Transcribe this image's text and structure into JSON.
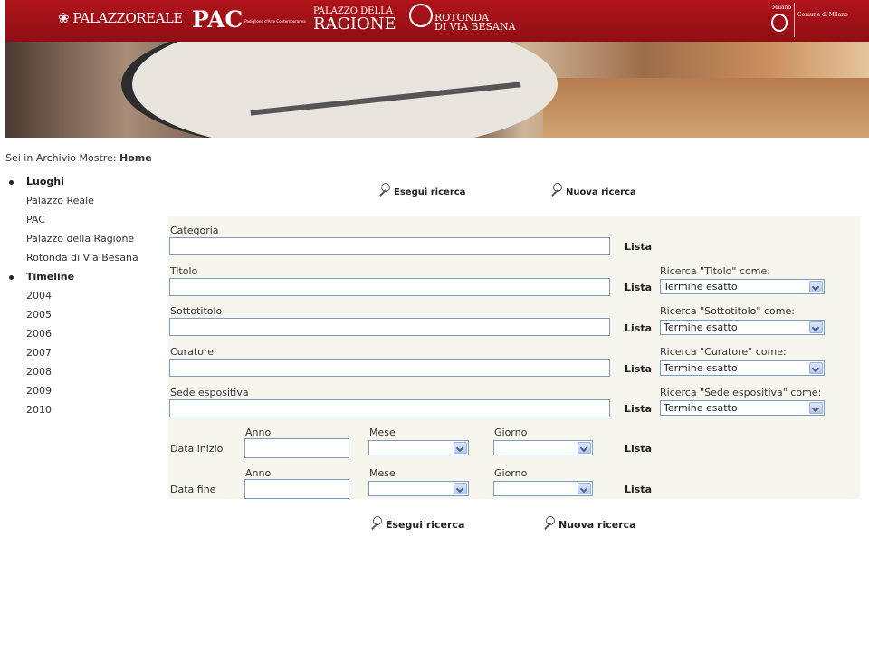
{
  "header": {
    "logos": {
      "palazzo_reale": "PALAZZOREALE",
      "pac": "PAC",
      "pac_sub": "Padiglione d'Arte Contemporanea",
      "ragione_top": "PALAZZO DELLA",
      "ragione_bottom": "RAGIONE",
      "rotonda_top": "ROTONDA",
      "rotonda_bottom": "DI VIA BESANA",
      "milano_city": "Milano",
      "milano_comune": "Comune di Milano"
    }
  },
  "breadcrumb": {
    "prefix": "Sei in Archivio Mostre: ",
    "current": "Home"
  },
  "sidebar": {
    "luoghi": {
      "title": "Luoghi",
      "items": [
        "Palazzo Reale",
        "PAC",
        "Palazzo della Ragione",
        "Rotonda di Via Besana"
      ]
    },
    "timeline": {
      "title": "Timeline",
      "items": [
        "2004",
        "2005",
        "2006",
        "2007",
        "2008",
        "2009",
        "2010"
      ]
    }
  },
  "actions": {
    "search": "Esegui ricerca",
    "new_search": "Nuova ricerca"
  },
  "form": {
    "lista": "Lista",
    "fields": {
      "categoria": {
        "label": "Categoria",
        "value": ""
      },
      "titolo": {
        "label": "Titolo",
        "value": "",
        "match_label": "Ricerca \"Titolo\" come:",
        "match_value": "Termine esatto"
      },
      "sottotitolo": {
        "label": "Sottotitolo",
        "value": "",
        "match_label": "Ricerca \"Sottotitolo\" come:",
        "match_value": "Termine esatto"
      },
      "curatore": {
        "label": "Curatore",
        "value": "",
        "match_label": "Ricerca \"Curatore\" come:",
        "match_value": "Termine esatto"
      },
      "sede": {
        "label": "Sede espositiva",
        "value": "",
        "match_label": "Ricerca \"Sede espositiva\" come:",
        "match_value": "Termine esatto"
      }
    },
    "dates": {
      "anno": "Anno",
      "mese": "Mese",
      "giorno": "Giorno",
      "inizio": {
        "label": "Data inizio",
        "anno": "",
        "mese": "",
        "giorno": ""
      },
      "fine": {
        "label": "Data fine",
        "anno": "",
        "mese": "",
        "giorno": ""
      }
    }
  }
}
